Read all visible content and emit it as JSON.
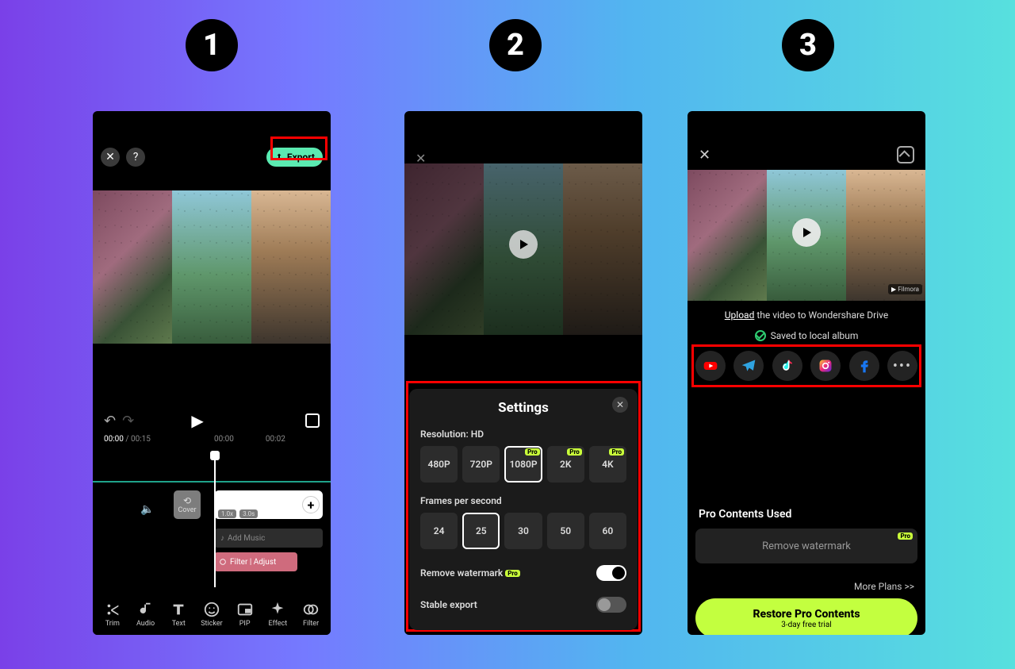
{
  "steps": [
    "1",
    "2",
    "3"
  ],
  "phone1": {
    "export_label": "Export",
    "time_current": "00:00",
    "time_total": "00:15",
    "ruler": [
      "00:00",
      "00:02"
    ],
    "cover_label": "Cover",
    "clip_badges": [
      "1.0x",
      "3.0s"
    ],
    "add_music_label": "Add Music",
    "filter_label": "Filter | Adjust",
    "tools": [
      "Trim",
      "Audio",
      "Text",
      "Sticker",
      "PIP",
      "Effect",
      "Filter"
    ]
  },
  "phone2": {
    "settings_title": "Settings",
    "resolution_label": "Resolution: HD",
    "resolutions": [
      {
        "label": "480P",
        "pro": false,
        "selected": false
      },
      {
        "label": "720P",
        "pro": false,
        "selected": false
      },
      {
        "label": "1080P",
        "pro": true,
        "selected": true
      },
      {
        "label": "2K",
        "pro": true,
        "selected": false
      },
      {
        "label": "4K",
        "pro": true,
        "selected": false
      }
    ],
    "fps_label": "Frames per second",
    "fps": [
      {
        "label": "24",
        "selected": false
      },
      {
        "label": "25",
        "selected": true
      },
      {
        "label": "30",
        "selected": false
      },
      {
        "label": "50",
        "selected": false
      },
      {
        "label": "60",
        "selected": false
      }
    ],
    "remove_wm_label": "Remove watermark",
    "remove_wm_pro": "Pro",
    "remove_wm_on": true,
    "stable_label": "Stable export",
    "stable_on": false
  },
  "phone3": {
    "watermark_text": "Filmora",
    "upload_link": "Upload",
    "upload_rest": " the video to Wondershare Drive",
    "saved_label": "Saved to local album",
    "social": [
      "youtube",
      "telegram",
      "tiktok",
      "instagram",
      "facebook",
      "more"
    ],
    "pro_contents_label": "Pro Contents Used",
    "remove_wm_label": "Remove watermark",
    "remove_wm_pro": "Pro",
    "more_plans": "More Plans >>",
    "restore_title": "Restore Pro Contents",
    "restore_sub": "3-day free trial"
  }
}
